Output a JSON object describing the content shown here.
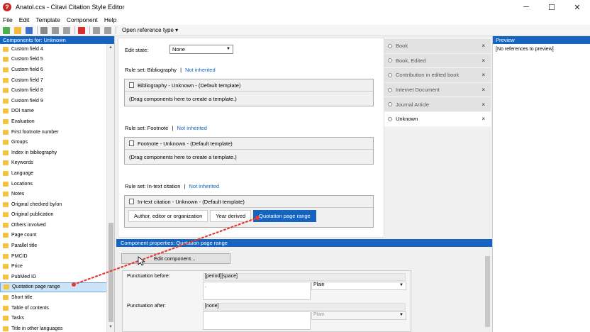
{
  "window": {
    "title": "Anatol.ccs - Citavi Citation Style Editor",
    "app_icon_glyph": "?",
    "minimize": "─",
    "maximize": "☐",
    "close": "✕"
  },
  "menu": [
    "File",
    "Edit",
    "Template",
    "Component",
    "Help"
  ],
  "toolbar": {
    "icons": [
      {
        "name": "new-icon",
        "color": "#4caf50"
      },
      {
        "name": "open-icon",
        "color": "#f5b83d"
      },
      {
        "name": "save-icon",
        "color": "#3f6fc6"
      },
      {
        "name": "cut-icon",
        "color": "#888888"
      },
      {
        "name": "copy-icon",
        "color": "#999999"
      },
      {
        "name": "paste-icon",
        "color": "#a0a0a0"
      },
      {
        "name": "delete-icon",
        "color": "#d32f2f"
      },
      {
        "name": "undo-icon",
        "color": "#9e9e9e"
      },
      {
        "name": "redo-icon",
        "color": "#9e9e9e"
      }
    ],
    "open_reference_type": "Open reference type",
    "dropdown_arrow": "▾"
  },
  "components_panel": {
    "header": "Components for: Unknown",
    "items": [
      "Custom field 4",
      "Custom field 5",
      "Custom field 6",
      "Custom field 7",
      "Custom field 8",
      "Custom field 9",
      "DOI name",
      "Evaluation",
      "First footnote number",
      "Groups",
      "Index in bibliography",
      "Keywords",
      "Language",
      "Locations",
      "Notes",
      "Original checked by/on",
      "Original publication",
      "Others involved",
      "Page count",
      "Parallel title",
      "PMCID",
      "Price",
      "PubMed ID",
      "Quotation page range",
      "Short title",
      "Table of contents",
      "Tasks",
      "Title in other languages"
    ],
    "selected_index": 23,
    "scroll_up": "▲",
    "scroll_down": "▼"
  },
  "editor": {
    "edit_state_label": "Edit state:",
    "edit_state_value": "None",
    "select_arrow": "▼",
    "rule_sets": [
      {
        "label": "Rule set: Bibliography",
        "separator": "|",
        "link": "Not inherited",
        "template_title": "Bibliography - Unknown - (Default template)",
        "template_body": "(Drag components here to create a template.)"
      },
      {
        "label": "Rule set: Footnote",
        "separator": "|",
        "link": "Not inherited",
        "template_title": "Footnote - Unknown - (Default template)",
        "template_body": "(Drag components here to create a template.)"
      },
      {
        "label": "Rule set: In-text citation",
        "separator": "|",
        "link": "Not inherited",
        "template_title": "In-text citation - Unknown - (Default template)",
        "chips": [
          "Author, editor or organization",
          "Year derived",
          "Quotation page range"
        ]
      }
    ]
  },
  "reference_tabs": {
    "items": [
      "Book",
      "Book, Edited",
      "Contribution in edited book",
      "Internet Document",
      "Journal Article",
      "Unknown"
    ],
    "active_index": 5,
    "close_glyph": "×"
  },
  "preview": {
    "header": "Preview",
    "body": "[No references to preview]"
  },
  "properties": {
    "header": "Component properties: Quotation page range",
    "edit_button": "Edit component...",
    "punct_before_label": "Punctuation before:",
    "punct_before_value": "[period][space]",
    "punct_before_input": ".",
    "punct_before_style": "Plain",
    "punct_after_label": "Punctuation after:",
    "punct_after_value": "[none]",
    "punct_after_style": "Plain"
  },
  "colors": {
    "accent": "#1565c0",
    "drag_line": "#e53935"
  }
}
